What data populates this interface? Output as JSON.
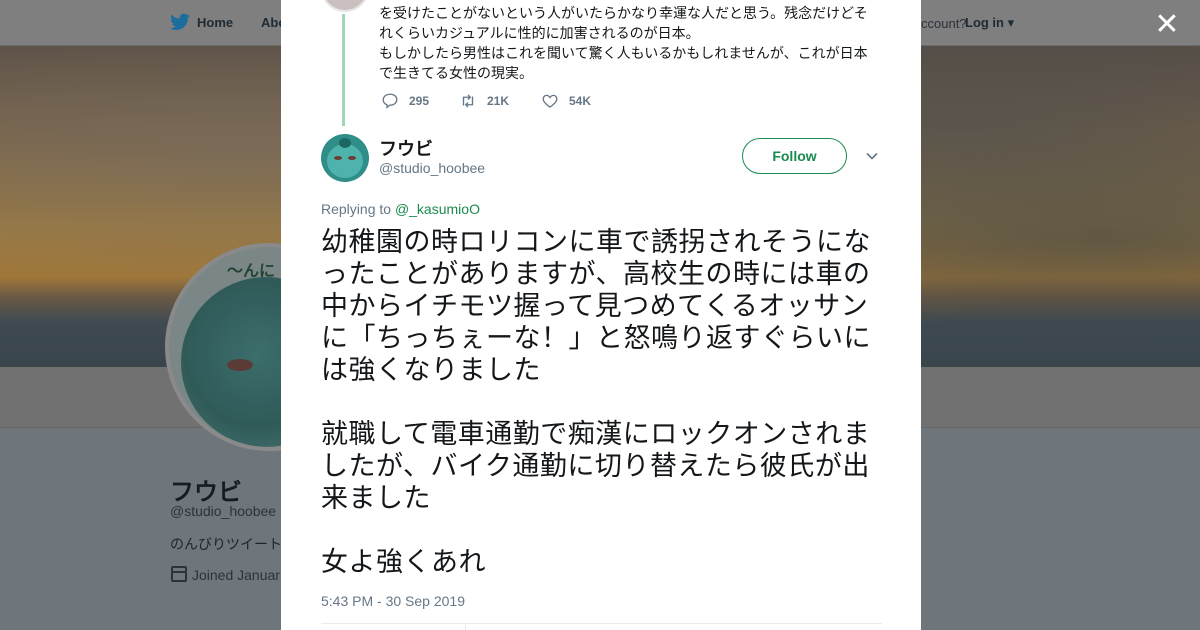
{
  "topbar": {
    "home_label": "Home",
    "about_label": "Abo",
    "have_account": "ccount?",
    "login_label": "Log in"
  },
  "background_profile": {
    "name": "フウビ",
    "handle": "@studio_hoobee",
    "bio": "のんびりツイート",
    "joined": "Joined Januar"
  },
  "previous_tweet": {
    "lines": [
      "を受けたことがないという人がいたらかなり幸運な人だと思う。残念だけどそ",
      "れくらいカジュアルに性的に加害されるのが日本。",
      "もしかしたら男性はこれを聞いて驚く人もいるかもしれませんが、これが日本",
      "で生きてる女性の現実。"
    ],
    "reply_count": "295",
    "retweet_count": "21K",
    "like_count": "54K"
  },
  "tweet": {
    "author_name": "フウビ",
    "author_handle": "@studio_hoobee",
    "follow_label": "Follow",
    "replying_prefix": "Replying to",
    "replying_to": "@_kasumioO",
    "paragraphs": [
      "幼稚園の時ロリコンに車で誘拐されそうになったことがありますが、高校生の時には車の中からイチモツ握って見つめてくるオッサンに「ちっちぇーな！」と怒鳴り返すぐらいには強くなりました",
      "就職して電車通勤で痴漢にロックオンされましたが、バイク通勤に切り替えたら彼氏が出来ました",
      "女よ強くあれ"
    ],
    "timestamp": "5:43 PM - 30 Sep 2019"
  },
  "colors": {
    "accent": "#1a8a4f",
    "muted": "#657786",
    "thread_line": "#9fd6b5"
  },
  "icons": {
    "close": "close-icon",
    "reply": "reply-icon",
    "retweet": "retweet-icon",
    "like": "heart-icon",
    "chevron": "chevron-down-icon",
    "bird": "twitter-bird-icon"
  }
}
